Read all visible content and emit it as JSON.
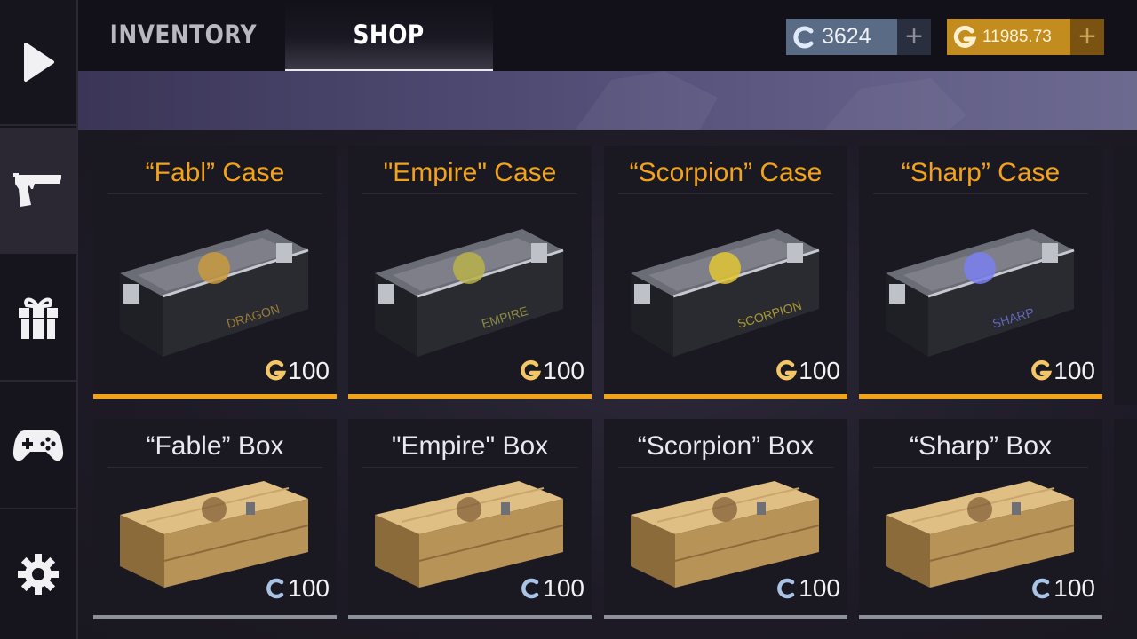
{
  "rail": [
    {
      "icon": "play-icon"
    },
    {
      "icon": "pistol-icon",
      "active": true
    },
    {
      "icon": "gift-icon"
    },
    {
      "icon": "gamepad-icon"
    },
    {
      "icon": "gear-icon"
    }
  ],
  "tabs": {
    "inventory": "INVENTORY",
    "shop": "SHOP"
  },
  "currencies": {
    "credits": {
      "value": "3624",
      "icon": "credits-coin-icon",
      "plus": "+"
    },
    "gold": {
      "value": "11985.73",
      "icon": "gold-coin-icon",
      "plus": "+"
    }
  },
  "colors": {
    "gold": "#f3a21b",
    "credits": "#a9c3e6",
    "case_bar": "#f0a21a",
    "box_bar": "#8d8f99"
  },
  "cases": [
    {
      "title": "“Fabl” Case",
      "price": "100",
      "currency": "gold",
      "emblem": "dragon",
      "color": "#c99a3f"
    },
    {
      "title": "\"Empire\" Case",
      "price": "100",
      "currency": "gold",
      "emblem": "empire",
      "color": "#b8b24c"
    },
    {
      "title": "“Scorpion” Case",
      "price": "100",
      "currency": "gold",
      "emblem": "scorpion",
      "color": "#e0c634"
    },
    {
      "title": "“Sharp” Case",
      "price": "100",
      "currency": "gold",
      "emblem": "sharp",
      "color": "#7a7ff0"
    }
  ],
  "boxes": [
    {
      "title": "“Fable” Box",
      "price": "100",
      "currency": "credits"
    },
    {
      "title": "\"Empire\" Box",
      "price": "100",
      "currency": "credits"
    },
    {
      "title": "“Scorpion” Box",
      "price": "100",
      "currency": "credits"
    },
    {
      "title": "“Sharp” Box",
      "price": "100",
      "currency": "credits"
    }
  ]
}
